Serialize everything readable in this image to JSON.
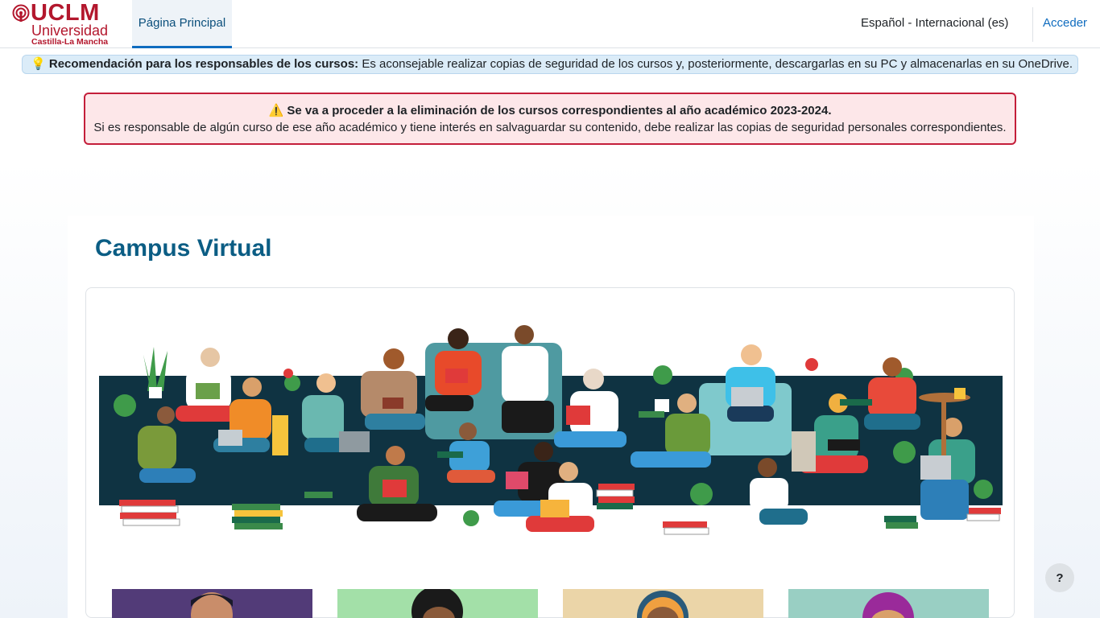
{
  "header": {
    "logo": {
      "brand": "UCLM",
      "line1": "Universidad",
      "line2": "Castilla-La Mancha"
    },
    "nav": [
      {
        "label": "Página Principal",
        "active": true
      }
    ],
    "language": "Español - Internacional (es)",
    "login": "Acceder"
  },
  "recommendation": {
    "icon": "lightbulb-icon",
    "bold": "Recomendación para los responsables de los cursos:",
    "text": "Es aconsejable realizar copias de seguridad de los cursos y, posteriormente, descargarlas en su PC y almacenarlas en su OneDrive."
  },
  "alert": {
    "icon": "warning-icon",
    "title": "Se va a proceder a la eliminación de los cursos correspondientes al año académico 2023-2024.",
    "body": "Si es responsable de algún curso de ese año académico y tiene interés en salvaguardar su contenido, debe realizar las copias de seguridad personales correspondientes."
  },
  "main": {
    "title": "Campus Virtual",
    "hero_image": "people-reading-illustration",
    "thumbnails": [
      {
        "name": "person-avatar-1",
        "bg": "#523b78"
      },
      {
        "name": "person-avatar-2",
        "bg": "#a3e0a8"
      },
      {
        "name": "person-avatar-3",
        "bg": "#ebd5a8"
      },
      {
        "name": "person-avatar-4",
        "bg": "#99cfc3"
      }
    ]
  },
  "help_button": {
    "label": "?"
  },
  "colors": {
    "brand": "#b3172d",
    "accent": "#0f6cbf",
    "title": "#0b5d84",
    "alert_border": "#c41e3a"
  }
}
